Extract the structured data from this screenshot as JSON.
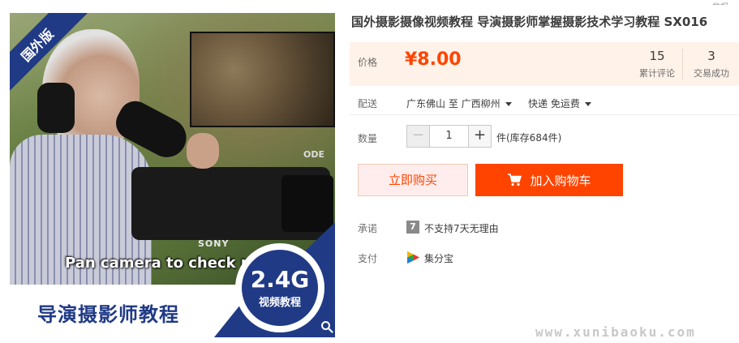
{
  "image": {
    "corner_ribbon": "国外版",
    "caption": "Pan camera to check m",
    "camera_brand": "SONY",
    "lens_text": "ODE",
    "bottom_title": "导演摄影师教程",
    "badge_size": "2.4G",
    "badge_label": "视频教程",
    "zoom_icon": "magnifier-icon"
  },
  "product": {
    "title": "国外摄影摄像视频教程 导演摄影师掌握摄影技术学习教程 SX016",
    "report_link": "举报"
  },
  "price": {
    "label": "价格",
    "value": "¥8.00",
    "color": "#ff4400",
    "reviews_count": "15",
    "reviews_label": "累计评论",
    "deals_count": "3",
    "deals_label": "交易成功"
  },
  "shipping": {
    "label": "配送",
    "route": "广东佛山 至  广西柳州",
    "method": "快递 免运费"
  },
  "quantity": {
    "label": "数量",
    "minus": "−",
    "value": "1",
    "plus": "+",
    "stock": "件(库存684件)"
  },
  "actions": {
    "buy_now": "立即购买",
    "add_to_cart": "加入购物车",
    "cart_icon": "cart-icon",
    "accent": "#ff4400"
  },
  "promise": {
    "label": "承诺",
    "icon_text": "7",
    "text": "不支持7天无理由"
  },
  "payment": {
    "label": "支付",
    "method": "集分宝",
    "icon": "jifenbao-icon"
  },
  "watermark": "www.xunibaoku.com"
}
